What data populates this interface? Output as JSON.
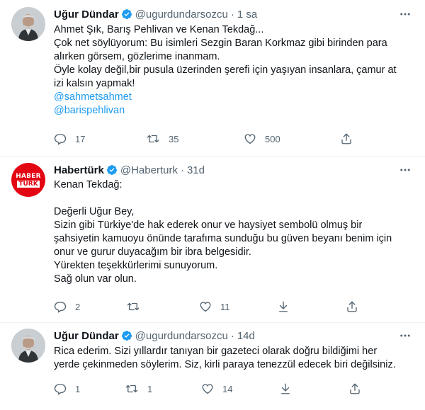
{
  "tweets": [
    {
      "author_name": "Uğur Dündar",
      "handle": "@ugurdundarsozcu",
      "time": "1 sa",
      "lines": [
        "Ahmet Şık, Barış Pehlivan ve Kenan Tekdağ...",
        "Çok net söylüyorum: Bu isimleri Sezgin Baran Korkmaz gibi birinden para",
        "alırken görsem, gözlerime inanmam.",
        "Öyle kolay değil,bir pusula üzerinden şerefi için yaşıyan insanlara, çamur at",
        "izi kalsın yapmak!"
      ],
      "mentions": [
        "@sahmetsahmet",
        "@barispehlivan"
      ],
      "replies": "17",
      "retweets": "35",
      "likes": "500"
    },
    {
      "author_name": "Habertürk",
      "handle": "@Haberturk",
      "time": "31d",
      "avatar_text_top": "HABER",
      "avatar_text_bottom": "TÜRK",
      "lines": [
        "Kenan Tekdağ:",
        "",
        "Değerli Uğur Bey,",
        "Sizin gibi Türkiye'de hak ederek onur ve haysiyet sembolü olmuş bir",
        "şahsiyetin kamuoyu önünde tarafıma sunduğu bu güven beyanı benim için",
        "onur ve gurur duyacağım bir ibra belgesidir.",
        "Yürekten teşekkürlerimi sunuyorum.",
        "Sağ olun var olun."
      ],
      "replies": "2",
      "retweets": "",
      "likes": "11"
    },
    {
      "author_name": "Uğur Dündar",
      "handle": "@ugurdundarsozcu",
      "time": "14d",
      "lines": [
        "Rica ederim. Sizi yıllardır tanıyan bir gazeteci olarak doğru bildiğimi her",
        "yerde çekinmeden söylerim. Siz, kirli paraya tenezzül edecek biri değilsiniz."
      ],
      "replies": "1",
      "retweets": "1",
      "likes": "14"
    }
  ],
  "colors": {
    "text": "#0f1419",
    "secondary": "#536471",
    "link": "#1d9bf0",
    "verified": "#1d9bf0",
    "divider": "#eff3f4",
    "haberturk_red": "#e30613"
  },
  "icons": [
    "verified-badge-icon",
    "more-icon",
    "reply-icon",
    "retweet-icon",
    "like-icon",
    "share-icon",
    "download-icon"
  ]
}
